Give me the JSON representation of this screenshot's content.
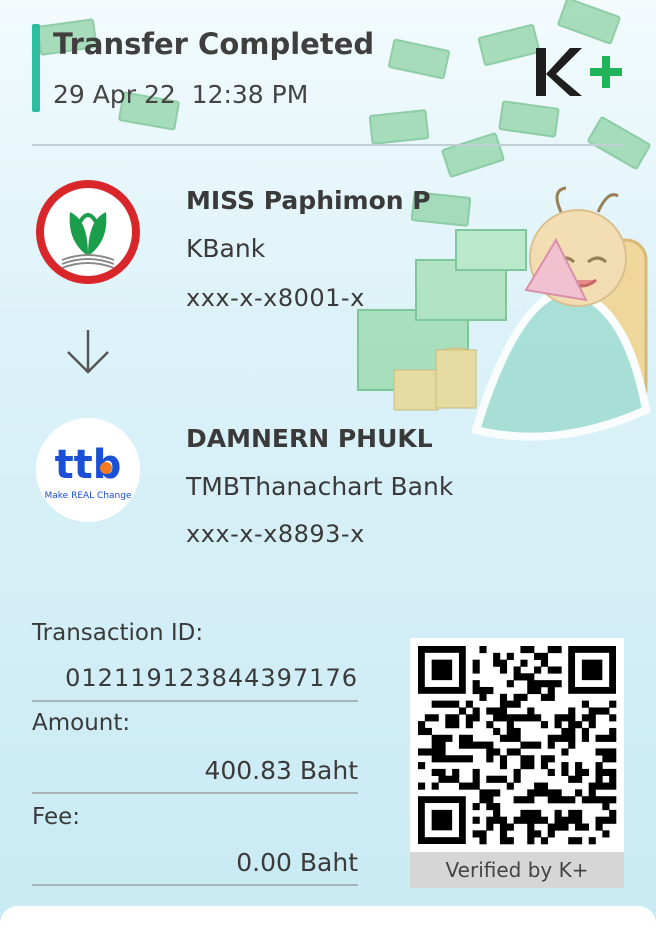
{
  "header": {
    "title": "Transfer Completed",
    "datetime": "29 Apr 22  12:38 PM",
    "brand_logo": "K+"
  },
  "sender": {
    "name": "MISS Paphimon P",
    "bank": "KBank",
    "account": "xxx-x-x8001-x",
    "logo_icon": "kbank-logo-icon"
  },
  "receiver": {
    "name": "DAMNERN PHUKL",
    "bank": "TMBThanachart Bank",
    "account": "xxx-x-x8893-x",
    "logo_icon": "ttb-logo-icon",
    "logo_text": "ttb",
    "logo_tagline": "Make REAL Change"
  },
  "details": {
    "transaction_id_label": "Transaction ID:",
    "transaction_id": "012119123844397176",
    "amount_label": "Amount:",
    "amount": "400.83 Baht",
    "fee_label": "Fee:",
    "fee": "0.00 Baht"
  },
  "qr": {
    "verified_label": "Verified by K+"
  },
  "colors": {
    "accent": "#2dbf9f",
    "kbank_red": "#d8262a",
    "kbank_green": "#1b9e4b",
    "ttb_blue": "#1a4fd6",
    "ttb_orange": "#f47b20"
  }
}
